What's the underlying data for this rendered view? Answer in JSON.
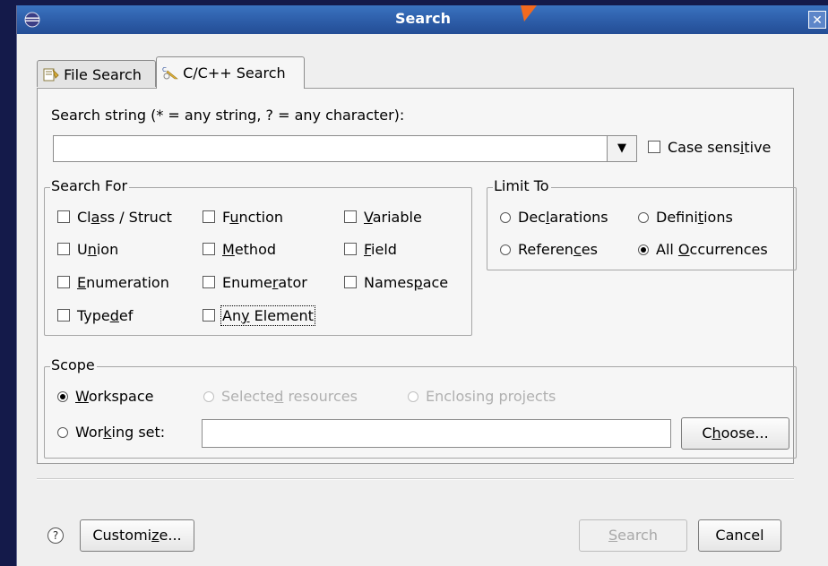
{
  "window": {
    "title": "Search",
    "close_icon": "close-icon"
  },
  "tabs": [
    {
      "label": "File Search",
      "icon": "file-search-icon",
      "active": false
    },
    {
      "label": "C/C++ Search",
      "icon": "cpp-search-icon",
      "active": true
    }
  ],
  "search_string": {
    "label_parts": [
      "Search string (* = any string, ? = any character):"
    ],
    "value": "",
    "case_sensitive": {
      "pre": "Case sens",
      "accel": "i",
      "post": "tive",
      "checked": false
    }
  },
  "search_for": {
    "title": "Search For",
    "items": [
      {
        "pre": "Cl",
        "accel": "a",
        "post": "ss / Struct",
        "checked": false
      },
      {
        "pre": "F",
        "accel": "u",
        "post": "nction",
        "checked": false
      },
      {
        "pre": "",
        "accel": "V",
        "post": "ariable",
        "checked": false
      },
      {
        "pre": "U",
        "accel": "n",
        "post": "ion",
        "checked": false
      },
      {
        "pre": "",
        "accel": "M",
        "post": "ethod",
        "checked": false
      },
      {
        "pre": "",
        "accel": "F",
        "post": "ield",
        "checked": false
      },
      {
        "pre": "",
        "accel": "E",
        "post": "numeration",
        "checked": false
      },
      {
        "pre": "Enume",
        "accel": "r",
        "post": "ator",
        "checked": false
      },
      {
        "pre": "Names",
        "accel": "p",
        "post": "ace",
        "checked": false
      },
      {
        "pre": "Type",
        "accel": "d",
        "post": "ef",
        "checked": false
      },
      {
        "pre": "An",
        "accel": "y",
        "post": " Element",
        "checked": false
      }
    ]
  },
  "limit_to": {
    "title": "Limit To",
    "items": [
      {
        "pre": "Dec",
        "accel": "l",
        "post": "arations",
        "selected": false
      },
      {
        "pre": "Defini",
        "accel": "t",
        "post": "ions",
        "selected": false
      },
      {
        "pre": "Referen",
        "accel": "c",
        "post": "es",
        "selected": false
      },
      {
        "pre": "All ",
        "accel": "O",
        "post": "ccurrences",
        "selected": true
      }
    ]
  },
  "scope": {
    "title": "Scope",
    "workspace": {
      "pre": "",
      "accel": "W",
      "post": "orkspace",
      "selected": true
    },
    "selected_resources": {
      "pre": "Selecte",
      "accel": "d",
      "post": " resources",
      "selected": false,
      "enabled": false
    },
    "enclosing_projects": {
      "pre": "Enclosing pro",
      "accel": "j",
      "post": "ects",
      "selected": false,
      "enabled": false
    },
    "working_set": {
      "pre": "Wor",
      "accel": "k",
      "post": "ing set:",
      "selected": false
    },
    "working_set_value": "",
    "choose_button": {
      "pre": "C",
      "accel": "h",
      "post": "oose..."
    }
  },
  "footer": {
    "help_icon": "help-icon",
    "customize_button": {
      "pre": "Customi",
      "accel": "z",
      "post": "e..."
    },
    "search_button": {
      "pre": "",
      "accel": "S",
      "post": "earch",
      "enabled": false
    },
    "cancel_label": "Cancel"
  }
}
